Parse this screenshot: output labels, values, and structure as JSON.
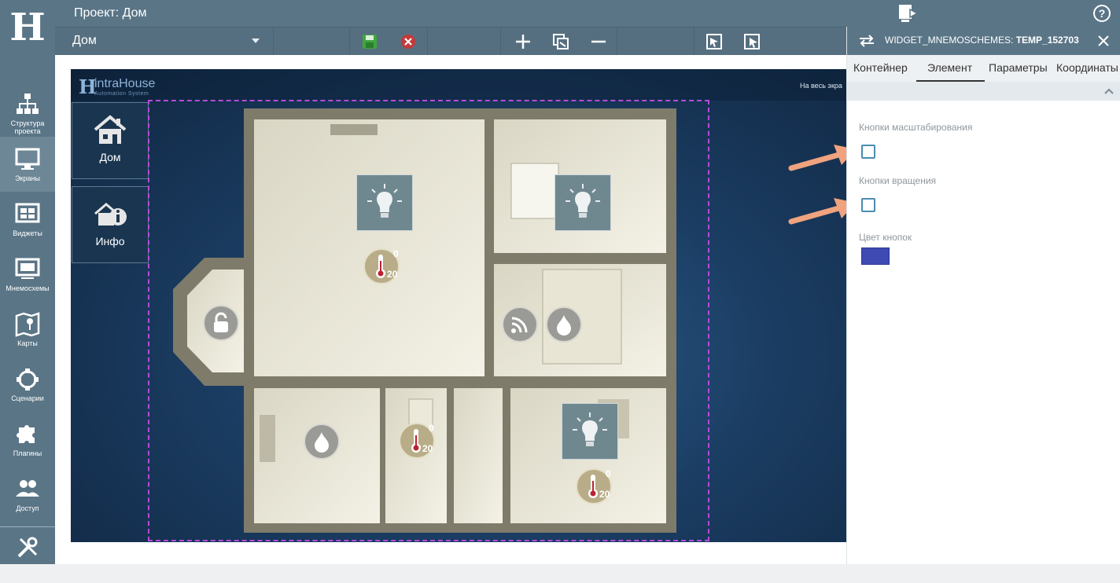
{
  "app": {
    "logo_letter": "H",
    "project_title": "Проект: Дом"
  },
  "sidebar": {
    "items": [
      {
        "label": "Структура проекта",
        "icon": "structure-icon"
      },
      {
        "label": "Экраны",
        "icon": "monitor-icon",
        "active": true
      },
      {
        "label": "Виджеты",
        "icon": "widgets-icon"
      },
      {
        "label": "Мнемосхемы",
        "icon": "mnemoscheme-icon"
      },
      {
        "label": "Карты",
        "icon": "map-icon"
      },
      {
        "label": "Сценарии",
        "icon": "scenario-icon"
      },
      {
        "label": "Плагины",
        "icon": "puzzle-icon"
      },
      {
        "label": "Доступ",
        "icon": "users-icon"
      },
      {
        "label": "",
        "icon": "tools-icon"
      }
    ]
  },
  "toolbar": {
    "screen_name": "Дом",
    "buttons": [
      "save-icon",
      "cancel-icon",
      "plus-icon",
      "copy-icon",
      "minus-icon",
      "select-icon",
      "cursor-select-icon"
    ]
  },
  "screen": {
    "brand_title": "intraHouse",
    "brand_subtitle": "Automation System",
    "fullscreen_link": "На весь экра",
    "nav": [
      {
        "label": "Дом",
        "icon": "house-icon"
      },
      {
        "label": "Инфо",
        "icon": "info-icon"
      }
    ],
    "thermostats": [
      {
        "top": "0",
        "bottom": "20"
      },
      {
        "top": "0",
        "bottom": "20"
      },
      {
        "top": "0",
        "bottom": "20"
      }
    ]
  },
  "panel": {
    "title_prefix": "WIDGET_MNEMOSCHEMES:",
    "title_id": "TEMP_152703",
    "tabs": [
      "Контейнер",
      "Элемент",
      "Параметры",
      "Координаты"
    ],
    "active_tab": "Элемент",
    "fields": {
      "zoom_label": "Кнопки масштабирования",
      "zoom_checked": false,
      "rotate_label": "Кнопки вращения",
      "rotate_checked": false,
      "color_label": "Цвет кнопок",
      "color_value": "#3f4ab2"
    }
  },
  "colors": {
    "sidebar": "#5a7586",
    "accent": "#b64bdb",
    "annotation_arrow": "#f0a37e"
  }
}
